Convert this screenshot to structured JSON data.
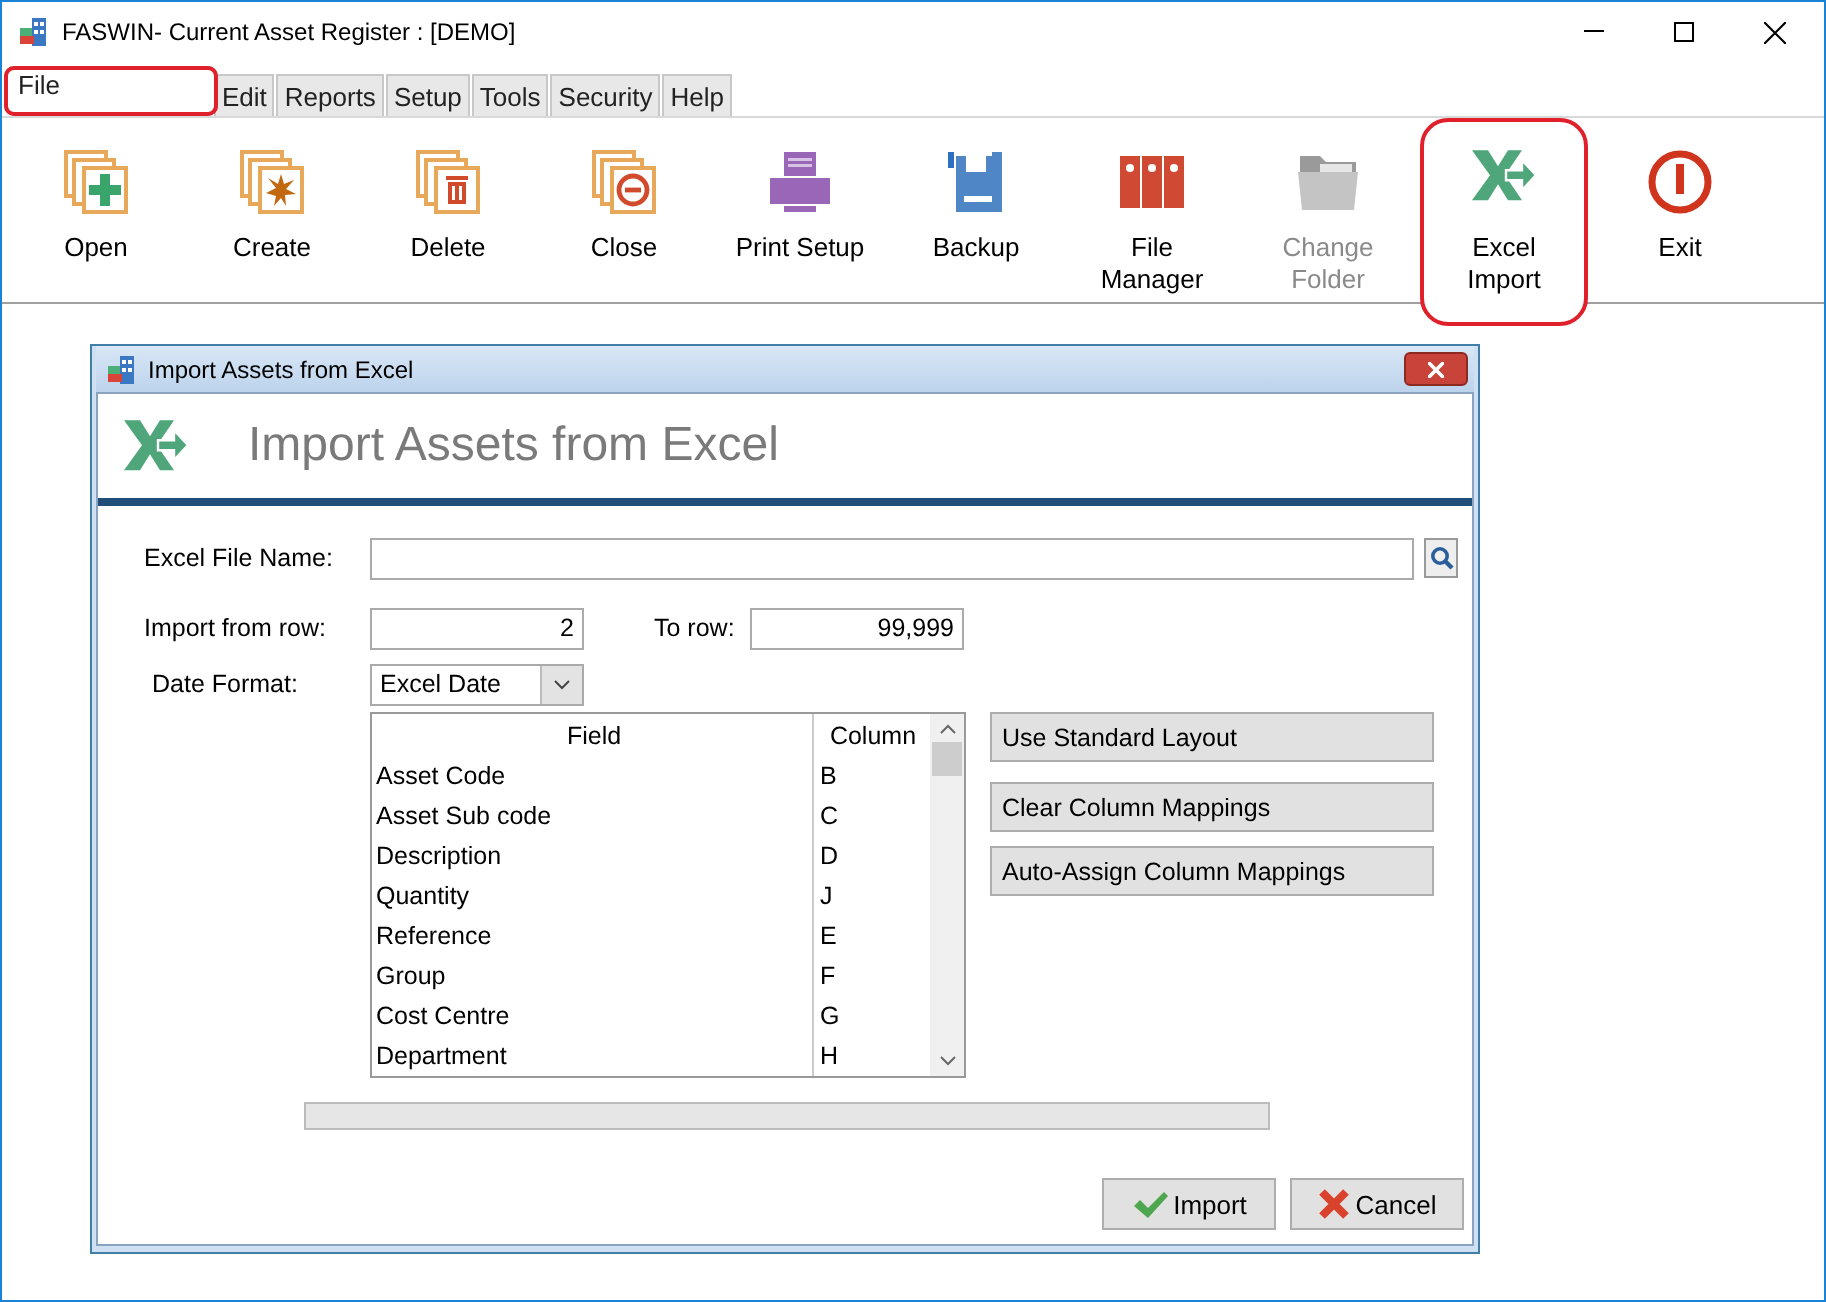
{
  "window": {
    "title": "FASWIN- Current Asset Register : [DEMO]"
  },
  "tabs": [
    {
      "label": "File",
      "selected": true,
      "highlighted": true
    },
    {
      "label": "Edit",
      "selected": false,
      "highlighted": false
    },
    {
      "label": "Reports",
      "selected": false,
      "highlighted": false
    },
    {
      "label": "Setup",
      "selected": false,
      "highlighted": false
    },
    {
      "label": "Tools",
      "selected": false,
      "highlighted": false
    },
    {
      "label": "Security",
      "selected": false,
      "highlighted": false
    },
    {
      "label": "Help",
      "selected": false,
      "highlighted": false
    }
  ],
  "ribbon": [
    {
      "kind": "open",
      "label": "Open",
      "disabled": false,
      "highlighted": false
    },
    {
      "kind": "create",
      "label": "Create",
      "disabled": false,
      "highlighted": false
    },
    {
      "kind": "delete",
      "label": "Delete",
      "disabled": false,
      "highlighted": false
    },
    {
      "kind": "close",
      "label": "Close",
      "disabled": false,
      "highlighted": false
    },
    {
      "kind": "printer",
      "label": "Print Setup",
      "disabled": false,
      "highlighted": false
    },
    {
      "kind": "backup",
      "label": "Backup",
      "disabled": false,
      "highlighted": false
    },
    {
      "kind": "binders",
      "label": "File Manager",
      "disabled": false,
      "highlighted": false
    },
    {
      "kind": "folder",
      "label": "Change Folder",
      "disabled": true,
      "highlighted": false
    },
    {
      "kind": "excel",
      "label": "Excel Import",
      "disabled": false,
      "highlighted": true
    },
    {
      "kind": "exit",
      "label": "Exit",
      "disabled": false,
      "highlighted": false
    }
  ],
  "dialog": {
    "title": "Import Assets from Excel",
    "heading": "Import Assets from Excel",
    "file_name": {
      "label": "Excel File Name:"
    },
    "from_row": {
      "label": "Import from row:",
      "value": "2"
    },
    "to_row": {
      "label": "To row:",
      "value": "99,999"
    },
    "date_format": {
      "label": "Date Format:",
      "value": "Excel Date"
    },
    "mapping_table": {
      "columns": [
        "Field",
        "Column"
      ],
      "rows": [
        [
          "Asset Code",
          "B"
        ],
        [
          "Asset Sub code",
          "C"
        ],
        [
          "Description",
          "D"
        ],
        [
          "Quantity",
          "J"
        ],
        [
          "Reference",
          "E"
        ],
        [
          "Group",
          "F"
        ],
        [
          "Cost Centre",
          "G"
        ],
        [
          "Department",
          "H"
        ]
      ]
    },
    "side_buttons": [
      "Use Standard Layout",
      "Clear Column Mappings",
      "Auto-Assign Column Mappings"
    ],
    "progress": {
      "level": 0
    },
    "buttons": [
      {
        "kind": "ok",
        "label": "Import"
      },
      {
        "kind": "cancel",
        "label": "Cancel"
      }
    ]
  }
}
